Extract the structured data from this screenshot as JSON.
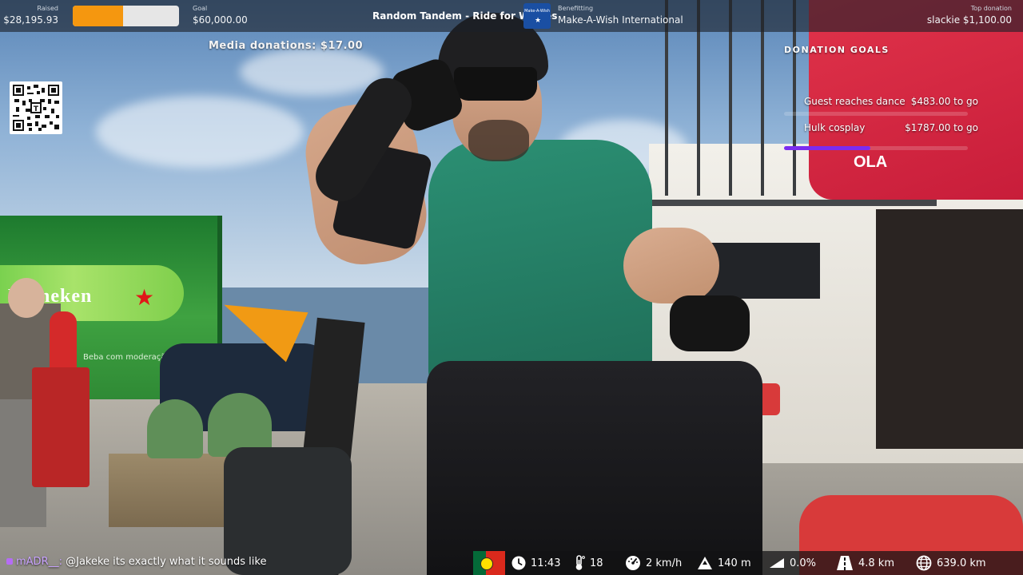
{
  "stream": {
    "title": "Random Tandem - Ride for Wishes",
    "media_donations": "Media donations: $17.00"
  },
  "fundraiser": {
    "raised_label": "Raised",
    "raised_value": "$28,195.93",
    "goal_label": "Goal",
    "goal_value": "$60,000.00",
    "progress_fraction": 0.47,
    "benefitting_label": "Benefitting",
    "benefitting_value": "Make-A-Wish International",
    "charity_logo_text": "Make-A-Wish",
    "top_donation_label": "Top donation",
    "top_donation_value": "slackie $1,100.00"
  },
  "donation_goals": {
    "title": "DONATION GOALS",
    "items": [
      {
        "name": "Guest reaches dance",
        "remaining": "$483.00 to go",
        "progress_fraction": 0.0
      },
      {
        "name": "Hulk cosplay",
        "remaining": "$1787.00 to go",
        "progress_fraction": 0.47
      }
    ]
  },
  "chat": {
    "user": "mADR__:",
    "message": "@Jakeke its exactly what it sounds like"
  },
  "stats": {
    "country_flag": "portugal-flag",
    "time": "11:43",
    "temperature": "18",
    "speed": "2 km/h",
    "altitude": "140 m",
    "grade": "0.0%",
    "segment_distance": "4.8 km",
    "total_distance": "639.0 km"
  },
  "colors": {
    "progress_fill": "#f5970f",
    "goal_fill": "#7b2cf0",
    "topbar_bg": "#1c2028"
  },
  "qr_code": "qr-code-icon"
}
